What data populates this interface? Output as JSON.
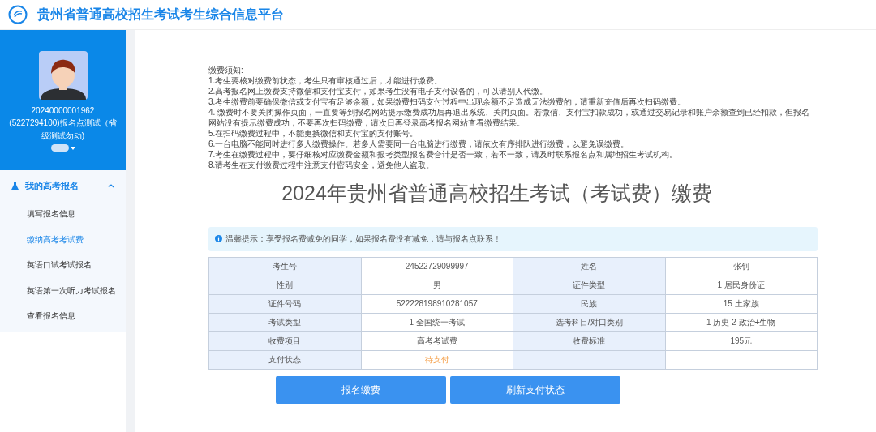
{
  "header": {
    "title": "贵州省普通高校招生考试考生综合信息平台"
  },
  "profile": {
    "id": "20240000001962",
    "unit": "(5227294100)报名点测试（省级测试勿动)"
  },
  "sidebar": {
    "group": {
      "label": "我的高考报名",
      "expanded": true
    },
    "items": [
      {
        "label": "填写报名信息",
        "selected": false
      },
      {
        "label": "缴纳高考考试费",
        "selected": true
      },
      {
        "label": "英语口试考试报名",
        "selected": false
      },
      {
        "label": "英语第一次听力考试报名",
        "selected": false
      },
      {
        "label": "查看报名信息",
        "selected": false
      }
    ]
  },
  "notice": {
    "heading": "缴费须知:",
    "lines": [
      "1.考生要核对缴费前状态，考生只有审核通过后，才能进行缴费。",
      "2.高考报名网上缴费支持微信和支付宝支付，如果考生没有电子支付设备的，可以请别人代缴。",
      "3.考生缴费前要确保微信或支付宝有足够余额，如果缴费扫码支付过程中出现余额不足造成无法缴费的，请重新充值后再次扫码缴费。",
      "4. 缴费时不要关闭操作页面，一直要等到报名网站提示缴费成功后再退出系统、关闭页面。若微信、支付宝扣款成功，或通过交易记录和账户余额查到已经扣款，但报名网站没有提示缴费成功，不要再次扫码缴费，请次日再登录高考报名网站查看缴费结果。",
      "5.在扫码缴费过程中，不能更换微信和支付宝的支付账号。",
      "6.一台电脑不能同时进行多人缴费操作。若多人需要同一台电脑进行缴费，请依次有序排队进行缴费，以避免误缴费。",
      "7.考生在缴费过程中，要仔细核对应缴费金额和报考类型报名费合计是否一致，若不一致，请及时联系报名点和属地招生考试机构。",
      "8.请考生在支付缴费过程中注意支付密码安全，避免他人盗取。"
    ]
  },
  "page_title": "2024年贵州省普通高校招生考试（考试费）缴费",
  "tip": "温馨提示：享受报名费减免的同学，如果报名费没有减免，请与报名点联系！",
  "table": {
    "rows": [
      [
        "考生号",
        "24522729099997",
        "姓名",
        "张钊"
      ],
      [
        "性别",
        "男",
        "证件类型",
        "1 居民身份证"
      ],
      [
        "证件号码",
        "522228198910281057",
        "民族",
        "15 土家族"
      ],
      [
        "考试类型",
        "1 全国统一考试",
        "选考科目/对口类别",
        "1 历史 2 政治+生物"
      ],
      [
        "收费项目",
        "高考考试费",
        "收费标准",
        "195元"
      ],
      [
        "支付状态",
        "待支付",
        "",
        ""
      ]
    ],
    "status_pending": true
  },
  "buttons": [
    "报名缴费",
    "刷新支付状态"
  ]
}
